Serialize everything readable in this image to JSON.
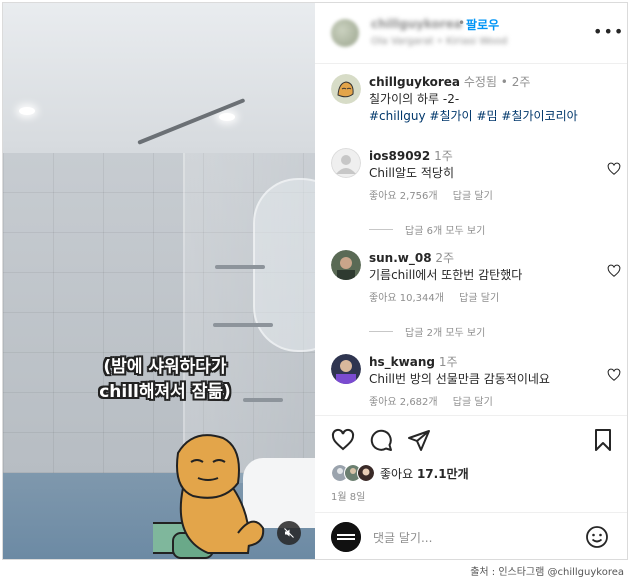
{
  "post_header": {
    "follow_dot": "•",
    "follow_label": "팔로우"
  },
  "caption": {
    "username": "chillguykorea",
    "edited": "수정됨 •",
    "age": "2주",
    "text": "칠가이의 하루 -2-",
    "hashtags": [
      "#chillguy",
      "#칠가이",
      "#밈",
      "#칠가이코리아"
    ]
  },
  "video": {
    "subtitle_line1": "(밤에 샤워하다가",
    "subtitle_line2": "chill해져서 잠듦)"
  },
  "comments": [
    {
      "username": "ios89092",
      "age": "1주",
      "text": "Chill알도 적당히",
      "likes": "좋아요 2,756개",
      "reply": "답글 달기",
      "view_replies": "답글 6개 모두 보기"
    },
    {
      "username": "sun.w_08",
      "age": "2주",
      "text": "기름chill에서 또한번 감탄했다",
      "likes": "좋아요 10,344개",
      "reply": "답글 달기",
      "view_replies": "답글 2개 모두 보기"
    },
    {
      "username": "hs_kwang",
      "age": "1주",
      "text": "Chill번 방의 선물만큼 감동적이네요",
      "likes": "좋아요 2,682개",
      "reply": "답글 달기"
    }
  ],
  "stats": {
    "likes_label": "좋아요",
    "likes_count": "17.1만개",
    "date": "1월 8일"
  },
  "comment_input": {
    "placeholder": "댓글 달기..."
  },
  "source_credit": "출처 : 인스타그램 @chillguykorea",
  "colors": {
    "link_blue": "#0095f6",
    "hashtag": "#00376b",
    "muted": "#8e8e8e"
  },
  "icons": [
    "heart-icon",
    "comment-icon",
    "share-icon",
    "bookmark-icon",
    "mute-icon",
    "emoji-icon",
    "more-icon"
  ]
}
